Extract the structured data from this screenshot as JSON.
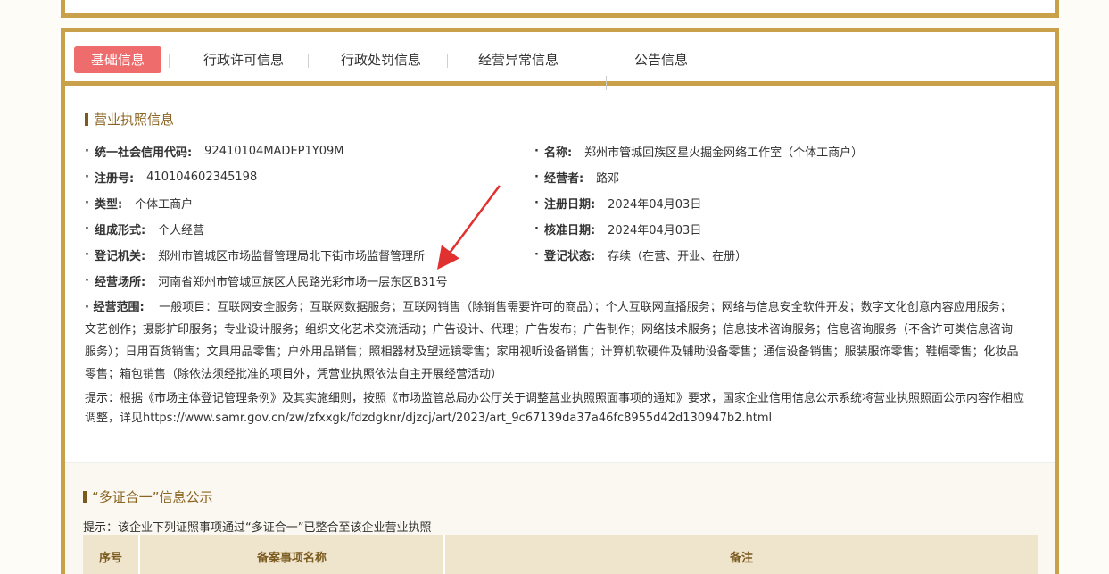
{
  "tabs": [
    {
      "label": "基础信息",
      "active": true
    },
    {
      "label": "行政许可信息",
      "active": false
    },
    {
      "label": "行政处罚信息",
      "active": false
    },
    {
      "label": "经营异常信息",
      "active": false
    },
    {
      "label": "公告信息",
      "active": false
    }
  ],
  "license_section": {
    "title": "营业执照信息",
    "fields": {
      "credit_code": {
        "label": "统一社会信用代码:",
        "value": "92410104MADEP1Y09M"
      },
      "name": {
        "label": "名称:",
        "value": "郑州市管城回族区星火掘金网络工作室（个体工商户）"
      },
      "reg_no": {
        "label": "注册号:",
        "value": "410104602345198"
      },
      "operator": {
        "label": "经营者:",
        "value": "路邓"
      },
      "type": {
        "label": "类型:",
        "value": "个体工商户"
      },
      "reg_date": {
        "label": "注册日期:",
        "value": "2024年04月03日"
      },
      "form": {
        "label": "组成形式:",
        "value": "个人经营"
      },
      "approve_date": {
        "label": "核准日期:",
        "value": "2024年04月03日"
      },
      "authority": {
        "label": "登记机关:",
        "value": "郑州市管城区市场监督管理局北下街市场监督管理所"
      },
      "status": {
        "label": "登记状态:",
        "value": "存续（在营、开业、在册）"
      },
      "address": {
        "label": "经营场所:",
        "value": "河南省郑州市管城回族区人民路光彩市场一层东区B31号"
      }
    },
    "scope": {
      "label": "经营范围:",
      "value": "一般项目：互联网安全服务；互联网数据服务；互联网销售（除销售需要许可的商品）；个人互联网直播服务；网络与信息安全软件开发；数字文化创意内容应用服务；文艺创作；摄影扩印服务；专业设计服务；组织文化艺术交流活动；广告设计、代理；广告发布；广告制作；网络技术服务；信息技术咨询服务；信息咨询服务（不含许可类信息咨询服务）；日用百货销售；文具用品零售；户外用品销售；照相器材及望远镜零售；家用视听设备销售；计算机软硬件及辅助设备零售；通信设备销售；服装服饰零售；鞋帽零售；化妆品零售；箱包销售（除依法须经批准的项目外，凭营业执照依法自主开展经营活动）"
    },
    "tip": "提示：根据《市场主体登记管理条例》及其实施细则，按照《市场监管总局办公厅关于调整营业执照照面事项的通知》要求，国家企业信用信息公示系统将营业执照照面公示内容作相应调整，详见https://www.samr.gov.cn/zw/zfxxgk/fdzdgknr/djzcj/art/2023/art_9c67139da37a46fc8955d42d130947b2.html"
  },
  "multi_cert_section": {
    "title": "“多证合一”信息公示",
    "tip": "提示：该企业下列证照事项通过“多证合一”已整合至该企业营业执照",
    "columns": [
      "序号",
      "备案事项名称",
      "备注"
    ]
  },
  "colors": {
    "accent_gold": "#c9a14a",
    "active_tab": "#ef6c6c",
    "arrow": "#e03030"
  }
}
